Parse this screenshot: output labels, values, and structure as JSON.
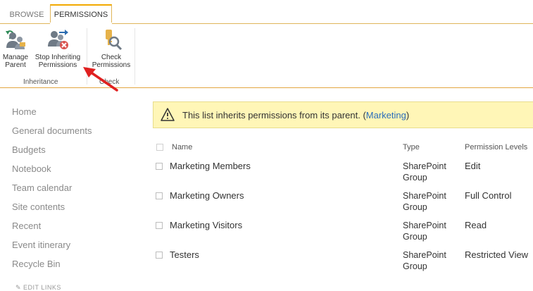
{
  "ribbon": {
    "tabs": [
      {
        "label": "BROWSE"
      },
      {
        "label": "PERMISSIONS"
      }
    ],
    "buttons": {
      "manage_parent": [
        "Manage",
        "Parent"
      ],
      "stop_inheriting": [
        "Stop Inheriting",
        "Permissions"
      ],
      "check_permissions": [
        "Check",
        "Permissions"
      ]
    },
    "groups": {
      "inheritance": "Inheritance",
      "check": "Check"
    }
  },
  "nav": {
    "items": [
      "Home",
      "General documents",
      "Budgets",
      "Notebook",
      "Team calendar",
      "Site contents",
      "Recent",
      "Event itinerary",
      "Recycle Bin"
    ],
    "edit_links": "EDIT LINKS"
  },
  "banner": {
    "text": "This list inherits permissions from its parent. (",
    "link": "Marketing",
    "close": ")"
  },
  "table": {
    "headers": {
      "name": "Name",
      "type": "Type",
      "level": "Permission Levels"
    },
    "rows": [
      {
        "name": "Marketing Members",
        "type_line1": "SharePoint",
        "type_line2": "Group",
        "level": "Edit"
      },
      {
        "name": "Marketing Owners",
        "type_line1": "SharePoint",
        "type_line2": "Group",
        "level": "Full Control"
      },
      {
        "name": "Marketing Visitors",
        "type_line1": "SharePoint",
        "type_line2": "Group",
        "level": "Read"
      },
      {
        "name": "Testers",
        "type_line1": "SharePoint",
        "type_line2": "Group",
        "level": "Restricted View"
      }
    ]
  },
  "colors": {
    "accent_tab": "#f2a900",
    "banner_bg": "#fff6b7",
    "link": "#2a6ebb",
    "arrow": "#e02020"
  }
}
